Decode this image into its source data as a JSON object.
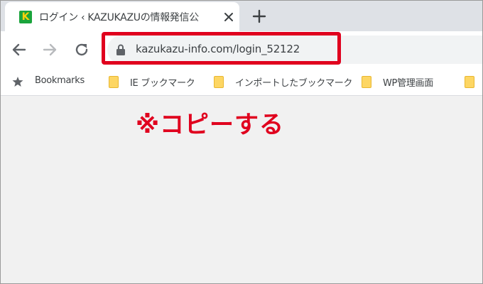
{
  "tab": {
    "favicon_letter": "K",
    "title": "ログイン ‹ KAZUKAZUの情報発信公",
    "close_icon": "close-icon",
    "new_tab_icon": "plus-icon"
  },
  "toolbar": {
    "back_icon": "arrow-left-icon",
    "forward_icon": "arrow-right-icon",
    "reload_icon": "reload-icon",
    "url": "kazukazu-info.com/login_52122"
  },
  "bookmarks": {
    "items": [
      {
        "label": "Bookmarks",
        "icon": "star-icon"
      },
      {
        "label": "IE ブックマーク",
        "icon": "folder-icon"
      },
      {
        "label": "インポートしたブックマーク",
        "icon": "folder-icon"
      },
      {
        "label": "WP管理画面",
        "icon": "folder-icon"
      },
      {
        "label": "",
        "icon": "folder-icon"
      }
    ]
  },
  "annotation": {
    "text": "※コピーする",
    "color": "#e0001e"
  }
}
